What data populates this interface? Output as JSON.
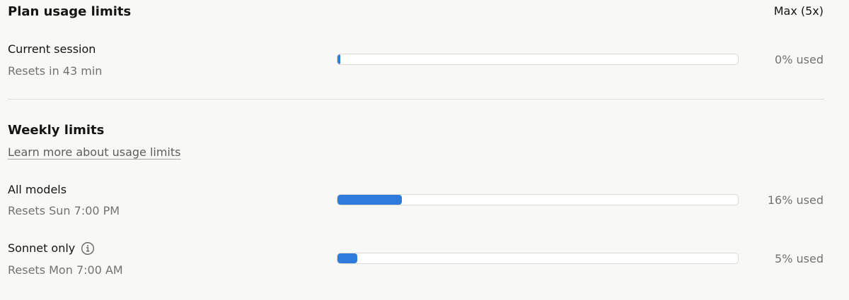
{
  "plan": {
    "title": "Plan usage limits",
    "badge": "Max (5x)"
  },
  "current_session": {
    "label": "Current session",
    "reset": "Resets in 43 min",
    "usage_percent": 0,
    "usage_text": "0% used"
  },
  "weekly": {
    "title": "Weekly limits",
    "learn_more": "Learn more about usage limits",
    "items": [
      {
        "label": "All models",
        "reset": "Resets Sun 7:00 PM",
        "usage_percent": 16,
        "usage_text": "16% used",
        "has_info": false
      },
      {
        "label": "Sonnet only",
        "reset": "Resets Mon 7:00 AM",
        "usage_percent": 5,
        "usage_text": "5% used",
        "has_info": true
      }
    ]
  },
  "colors": {
    "bar_fill": "#2f7bdb",
    "bar_track": "#ffffff",
    "background": "#f8f8f6"
  },
  "icons": {
    "info": "info-circle-icon"
  }
}
